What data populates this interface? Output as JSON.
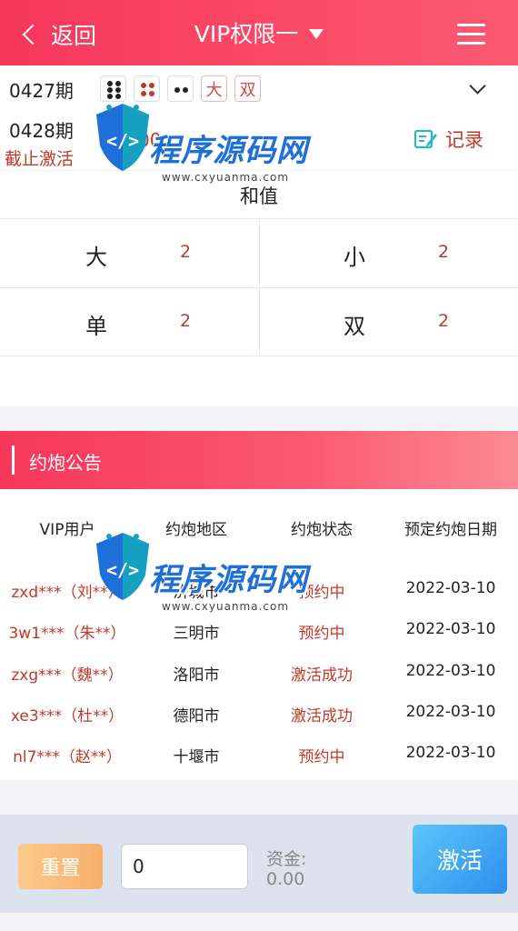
{
  "header": {
    "back_label": "返回",
    "title": "VIP权限一"
  },
  "issue": {
    "prev_issue": "0427期",
    "dice": [
      {
        "pips": 6,
        "color": "#222222"
      },
      {
        "pips": 4,
        "color": "#c0392b"
      },
      {
        "pips": 2,
        "color": "#222222"
      }
    ],
    "tags": [
      "大",
      "双"
    ],
    "current_issue": "0428期",
    "deadline_label": "截止激活",
    "countdown": "00",
    "record_label": "记录"
  },
  "sum": {
    "title": "和值",
    "cells": [
      {
        "label": "大",
        "value": "2"
      },
      {
        "label": "小",
        "value": "2"
      },
      {
        "label": "单",
        "value": "2"
      },
      {
        "label": "双",
        "value": "2"
      }
    ]
  },
  "announcement": {
    "title": "约炮公告",
    "columns": [
      "VIP用户",
      "约炮地区",
      "约炮状态",
      "预定约炮日期"
    ],
    "rows": [
      {
        "user": "zxd***（刘**）",
        "city": "济城市",
        "status": "预约中",
        "date": "2022-03-10"
      },
      {
        "user": "3w1***（朱**）",
        "city": "三明市",
        "status": "预约中",
        "date": "2022-03-10"
      },
      {
        "user": "zxg***（魏**）",
        "city": "洛阳市",
        "status": "激活成功",
        "date": "2022-03-10"
      },
      {
        "user": "xe3***（杜**）",
        "city": "德阳市",
        "status": "激活成功",
        "date": "2022-03-10"
      },
      {
        "user": "nl7***（赵**）",
        "city": "十堰市",
        "status": "预约中",
        "date": "2022-03-10"
      }
    ]
  },
  "footer": {
    "reset_label": "重置",
    "amount_value": "0",
    "fund_label": "资金:",
    "fund_value": "0.00",
    "activate_label": "激活"
  },
  "watermark": {
    "text": "程序源码网",
    "url": "www.cxyuanma.com"
  },
  "colors": {
    "accent": "#f6375a",
    "accent_light": "#fb5a72",
    "highlight_red": "#c0392b",
    "activate_blue": "#2d8ff0",
    "reset_orange": "#f7b06c",
    "footer_bg": "#dde3ee"
  },
  "icons": {
    "back": "chevron-left-icon",
    "title_caret": "caret-down-icon",
    "menu": "hamburger-menu-icon",
    "collapse": "chevron-down-icon",
    "record": "edit-record-icon"
  }
}
